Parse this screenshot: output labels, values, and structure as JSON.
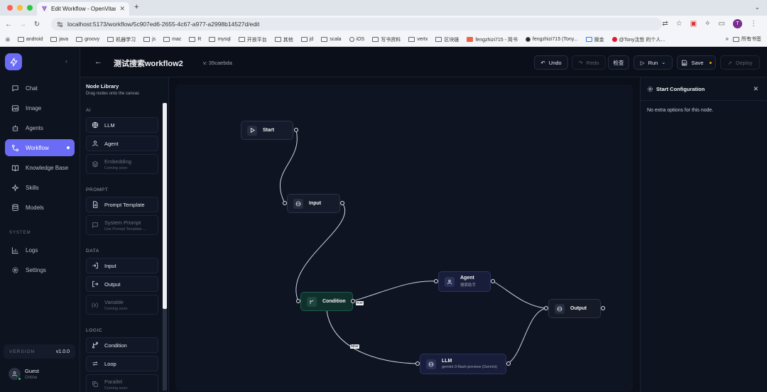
{
  "browser": {
    "tab_title": "Edit Workflow - OpenVitamin",
    "url": "localhost:5173/workflow/5c907ed6-2655-4c67-a977-a2998b14527d/edit",
    "profile_initial": "T",
    "bookmarks": [
      "android",
      "java",
      "groovy",
      "机器学习",
      "js",
      "mac",
      "R",
      "mysql",
      "开放平台",
      "其他",
      "jd",
      "scala",
      "iOS",
      "写书资料",
      "vertx",
      "区块链",
      "fengzhizi715 - 简书",
      "fengzhizi715 (Tony...",
      "掘金",
      "@Tony沈哲 的个人..."
    ],
    "bookmarks_more": "»",
    "bookmarks_all": "所有书签"
  },
  "sidebar": {
    "items": [
      {
        "label": "Chat",
        "icon": "chat-icon"
      },
      {
        "label": "Image",
        "icon": "image-icon"
      },
      {
        "label": "Agents",
        "icon": "agents-icon"
      },
      {
        "label": "Workflow",
        "icon": "workflow-icon"
      },
      {
        "label": "Knowledge Base",
        "icon": "book-icon"
      },
      {
        "label": "Skills",
        "icon": "sparkle-icon"
      },
      {
        "label": "Models",
        "icon": "database-icon"
      }
    ],
    "system_label": "SYSTEM",
    "system_items": [
      {
        "label": "Logs",
        "icon": "chart-icon"
      },
      {
        "label": "Settings",
        "icon": "gear-icon"
      }
    ],
    "version_label": "VERSION",
    "version_value": "v1.0.0",
    "user_name": "Guest",
    "user_status": "Online",
    "accent": "#6b6cf6"
  },
  "header": {
    "title": "测试搜索workflow2",
    "version": "v: 35caebda",
    "undo": "Undo",
    "redo": "Redo",
    "check": "检查",
    "run": "Run",
    "save": "Save",
    "deploy": "Deploy"
  },
  "library": {
    "title": "Node Library",
    "subtitle": "Drag nodes onto the canvas",
    "categories": [
      "AI",
      "PROMPT",
      "DATA",
      "LOGIC"
    ],
    "items": {
      "llm": "LLM",
      "agent": "Agent",
      "embedding": "Embedding",
      "embedding_sub": "Coming soon",
      "prompt_template": "Prompt Template",
      "system_prompt": "System Prompt",
      "system_prompt_sub": "Use Prompt Template ...",
      "input": "Input",
      "output": "Output",
      "variable": "Variable",
      "variable_sub": "Coming soon",
      "condition": "Condition",
      "loop": "Loop",
      "parallel": "Parallel",
      "parallel_sub": "Coming soon"
    }
  },
  "canvas": {
    "nodes": {
      "start": "Start",
      "input": "Input",
      "condition": "Condition",
      "agent": "Agent",
      "agent_sub": "搜索助手",
      "llm": "LLM",
      "llm_sub": "gemini-3-flash-preview (Gemini)",
      "output": "Output"
    },
    "edge_true": "true",
    "edge_false": "false"
  },
  "config": {
    "title": "Start Configuration",
    "message": "No extra options for this node."
  }
}
